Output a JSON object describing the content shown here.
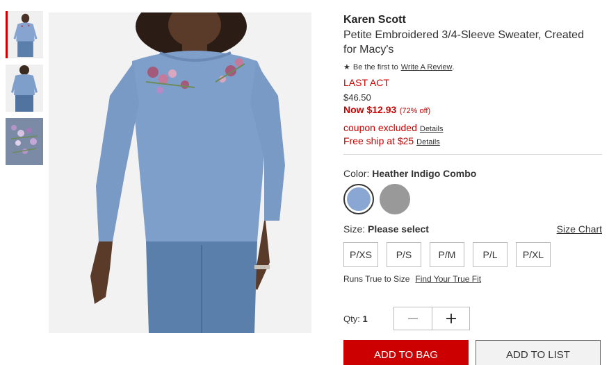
{
  "product": {
    "brand": "Karen Scott",
    "title": "Petite Embroidered 3/4-Sleeve Sweater, Created for Macy's"
  },
  "reviews": {
    "prefix": "Be the first to",
    "link": "Write A Review",
    "suffix": ".",
    "icon": "star-icon"
  },
  "pricing": {
    "badge": "LAST ACT",
    "original": "$46.50",
    "now": "Now $12.93",
    "percent_off": "(72% off)",
    "coupon": "coupon excluded",
    "coupon_details": "Details",
    "shipping": "Free ship at $25",
    "shipping_details": "Details"
  },
  "color": {
    "label": "Color:",
    "selected": "Heather Indigo Combo",
    "swatches": [
      {
        "name": "Heather Indigo Combo",
        "hex": "#8aa6d2",
        "selected": true
      },
      {
        "name": "Gray",
        "hex": "#999999",
        "selected": false
      }
    ]
  },
  "size": {
    "label": "Size:",
    "prompt": "Please select",
    "chart_link": "Size Chart",
    "options": [
      "P/XS",
      "P/S",
      "P/M",
      "P/L",
      "P/XL"
    ],
    "fit_text": "Runs True to Size",
    "fit_link": "Find Your True Fit"
  },
  "quantity": {
    "label": "Qty:",
    "value": "1",
    "decrement_icon": "minus-icon",
    "increment_icon": "plus-icon"
  },
  "actions": {
    "add_to_bag": "ADD TO BAG",
    "add_to_list": "ADD TO LIST"
  },
  "colors": {
    "accent_red": "#cc0000",
    "sweater_blue": "#7f9fcb",
    "jeans_blue": "#5b7fab"
  }
}
